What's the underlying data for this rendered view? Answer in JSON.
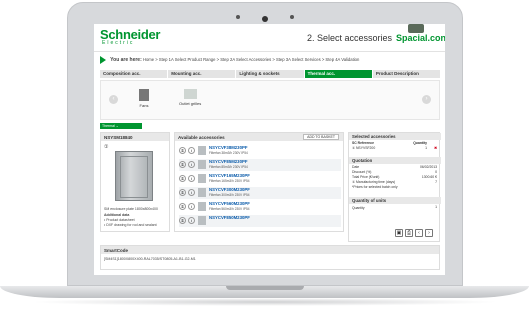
{
  "header": {
    "logo_main": "Schneider",
    "logo_sub": "Electric",
    "step_title": "2. Select accessories",
    "brand": "Spacial.conf"
  },
  "breadcrumb": {
    "you_are_here": "You are here:",
    "path": "Home > Step 1A Select Product Range > Step 2A Select Accessories > Step 3A Select Services > Step 4A Validation"
  },
  "tabs": [
    {
      "label": "Composition acc."
    },
    {
      "label": "Mounting acc."
    },
    {
      "label": "Lighting & sockets"
    },
    {
      "label": "Thermal acc."
    },
    {
      "label": "Product Description"
    }
  ],
  "categories": [
    {
      "label": "Fans"
    },
    {
      "label": "Outlet grilles"
    }
  ],
  "section_tab": "Thermal ⌄",
  "left_panel": {
    "title": "NSYSM18840",
    "item_no": "①",
    "caption": "SM enclosure plate 1800x800x400",
    "additional_title": "Additional data",
    "bullets": [
      "• Product datasheet",
      "• DXF drawing for rod and sealant"
    ]
  },
  "middle_panel": {
    "title": "Available accessories",
    "add_button": "ADD TO BASKET",
    "rows": [
      {
        "num": "①",
        "ref": "NSYCVF38M230PF",
        "desc": "Filterfan 38m3/h 230V IP54"
      },
      {
        "num": "①",
        "ref": "NSYCVF85M230PF",
        "desc": "Filterfan 85m3/h 230V IP54"
      },
      {
        "num": "①",
        "ref": "NSYCVF165M230PF",
        "desc": "Filterfan 165m3/h 230V IP54"
      },
      {
        "num": "①",
        "ref": "NSYCVF300M230PF",
        "desc": "Filterfan 300m3/h 230V IP54"
      },
      {
        "num": "①",
        "ref": "NSYCVF560M230PF",
        "desc": "Filterfan 560m3/h 230V IP54"
      },
      {
        "num": "①",
        "ref": "NSYCVF850M230PF",
        "desc": ""
      }
    ]
  },
  "right_panel": {
    "selected_title": "Selected accessories",
    "col_ref": "SC Reference",
    "col_qty": "Quantity",
    "selected_ref": "① NSYVSF200",
    "selected_qty": "1",
    "quotation_title": "Quotation",
    "date_label": "Date",
    "date_value": "06/02/2013",
    "discount_label": "Discount (%)",
    "discount_value": "0",
    "total_label": "Total Price (€/unit)",
    "total_value": "1300.60 €",
    "mfg_label": "① Manufacturing time (days)",
    "mfg_value": "7",
    "note": "*Prices for selected batch only",
    "qty_units_title": "Quantity of units",
    "qty_label": "Quantity",
    "qty_value": "1"
  },
  "smartcode": {
    "title": "SmartCode",
    "value": "[SM4S1]1800X800X400-RAL7035/ST0805-A1-B1-G2-M1"
  }
}
